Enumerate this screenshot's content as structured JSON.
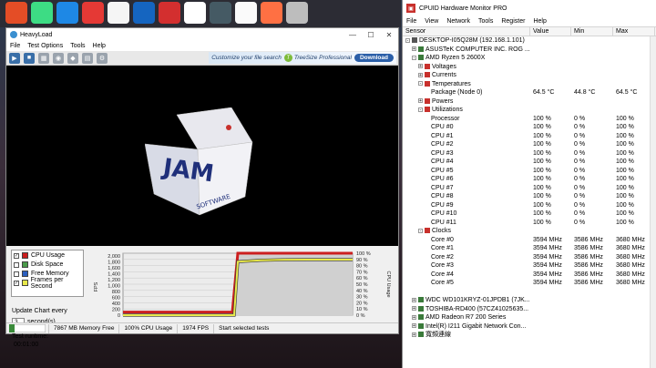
{
  "taskbar_icons": [
    "chrome-icon",
    "android-icon",
    "download-icon",
    "square-icon",
    "pinball-icon",
    "pdf-icon",
    "photo-icon",
    "cube-icon",
    "pdf-red-icon",
    "calendar-icon",
    "fire-icon",
    "tv-icon"
  ],
  "heavyload": {
    "title": "HeavyLoad",
    "menu": [
      "File",
      "Test Options",
      "Tools",
      "Help"
    ],
    "ad_text": "Customize your file search",
    "ad_brand": "TreeSize Professional",
    "ad_button": "Download",
    "legend": [
      {
        "label": "CPU Usage",
        "checked": true,
        "color": "#cc1f1f"
      },
      {
        "label": "Disk Space",
        "checked": false,
        "color": "#4a9a4a"
      },
      {
        "label": "Free Memory",
        "checked": false,
        "color": "#2b5fbf"
      },
      {
        "label": "Frames per Second",
        "checked": true,
        "color": "#e8e84a"
      }
    ],
    "update_label": "Update Chart every",
    "update_value": "3",
    "update_unit": "second(s)",
    "runtime_label": "Test runtime:",
    "runtime_value": "00:01:00",
    "status": [
      "7867 MB Memory Free",
      "100% CPU Usage",
      "1974 FPS",
      "Start selected tests"
    ]
  },
  "chart_data": {
    "type": "area",
    "x": [
      0,
      1,
      2,
      3,
      4,
      5,
      6,
      7,
      8,
      9,
      10
    ],
    "series": [
      {
        "name": "CPU Usage",
        "values": [
          5,
          5,
          5,
          5,
          5,
          100,
          100,
          100,
          100,
          100,
          100
        ]
      },
      {
        "name": "Frames per Second",
        "values": [
          0,
          0,
          0,
          0,
          0,
          1900,
          1950,
          1970,
          1974,
          1974,
          1974
        ]
      }
    ],
    "ylabel_left": "FPS",
    "ylabel_right": "CPU Usage",
    "ylim_left": [
      0,
      2200
    ],
    "yticks_left": [
      "2,000",
      "1,800",
      "1,600",
      "1,400",
      "1,200",
      "1,000",
      "800",
      "600",
      "400",
      "200",
      "0"
    ],
    "ylim_right": [
      0,
      100
    ],
    "yticks_right": [
      "100 %",
      "90 %",
      "80 %",
      "70 %",
      "60 %",
      "50 %",
      "40 %",
      "30 %",
      "20 %",
      "10 %",
      "0 %"
    ],
    "grid": true
  },
  "hwmonitor": {
    "title": "CPUID Hardware Monitor PRO",
    "menu": [
      "File",
      "View",
      "Network",
      "Tools",
      "Register",
      "Help"
    ],
    "columns": [
      "Sensor",
      "Value",
      "Min",
      "Max"
    ],
    "rows": [
      {
        "name": "DESKTOP-I05Q28M (192.168.1.101)",
        "value": "",
        "min": "",
        "max": "",
        "indent": 0,
        "exp": "-"
      },
      {
        "name": "ASUSTeK COMPUTER INC. ROG ...",
        "value": "",
        "min": "",
        "max": "",
        "indent": 1,
        "exp": "+"
      },
      {
        "name": "AMD Ryzen 5 2600X",
        "value": "",
        "min": "",
        "max": "",
        "indent": 1,
        "exp": "-"
      },
      {
        "name": "Voltages",
        "value": "",
        "min": "",
        "max": "",
        "indent": 2,
        "exp": "+"
      },
      {
        "name": "Currents",
        "value": "",
        "min": "",
        "max": "",
        "indent": 2,
        "exp": "+"
      },
      {
        "name": "Temperatures",
        "value": "",
        "min": "",
        "max": "",
        "indent": 2,
        "exp": "-"
      },
      {
        "name": "Package (Node 0)",
        "value": "64.5 °C",
        "min": "44.8 °C",
        "max": "64.5 °C",
        "indent": 4,
        "exp": ""
      },
      {
        "name": "Powers",
        "value": "",
        "min": "",
        "max": "",
        "indent": 2,
        "exp": "+"
      },
      {
        "name": "Utilizations",
        "value": "",
        "min": "",
        "max": "",
        "indent": 2,
        "exp": "-"
      },
      {
        "name": "Processor",
        "value": "100 %",
        "min": "0 %",
        "max": "100 %",
        "indent": 4,
        "exp": ""
      },
      {
        "name": "CPU #0",
        "value": "100 %",
        "min": "0 %",
        "max": "100 %",
        "indent": 4,
        "exp": ""
      },
      {
        "name": "CPU #1",
        "value": "100 %",
        "min": "0 %",
        "max": "100 %",
        "indent": 4,
        "exp": ""
      },
      {
        "name": "CPU #2",
        "value": "100 %",
        "min": "0 %",
        "max": "100 %",
        "indent": 4,
        "exp": ""
      },
      {
        "name": "CPU #3",
        "value": "100 %",
        "min": "0 %",
        "max": "100 %",
        "indent": 4,
        "exp": ""
      },
      {
        "name": "CPU #4",
        "value": "100 %",
        "min": "0 %",
        "max": "100 %",
        "indent": 4,
        "exp": ""
      },
      {
        "name": "CPU #5",
        "value": "100 %",
        "min": "0 %",
        "max": "100 %",
        "indent": 4,
        "exp": ""
      },
      {
        "name": "CPU #6",
        "value": "100 %",
        "min": "0 %",
        "max": "100 %",
        "indent": 4,
        "exp": ""
      },
      {
        "name": "CPU #7",
        "value": "100 %",
        "min": "0 %",
        "max": "100 %",
        "indent": 4,
        "exp": ""
      },
      {
        "name": "CPU #8",
        "value": "100 %",
        "min": "0 %",
        "max": "100 %",
        "indent": 4,
        "exp": ""
      },
      {
        "name": "CPU #9",
        "value": "100 %",
        "min": "0 %",
        "max": "100 %",
        "indent": 4,
        "exp": ""
      },
      {
        "name": "CPU #10",
        "value": "100 %",
        "min": "0 %",
        "max": "100 %",
        "indent": 4,
        "exp": ""
      },
      {
        "name": "CPU #11",
        "value": "100 %",
        "min": "0 %",
        "max": "100 %",
        "indent": 4,
        "exp": ""
      },
      {
        "name": "Clocks",
        "value": "",
        "min": "",
        "max": "",
        "indent": 2,
        "exp": "-"
      },
      {
        "name": "Core #0",
        "value": "3594 MHz",
        "min": "3586 MHz",
        "max": "3680 MHz",
        "indent": 4,
        "exp": ""
      },
      {
        "name": "Core #1",
        "value": "3594 MHz",
        "min": "3586 MHz",
        "max": "3680 MHz",
        "indent": 4,
        "exp": ""
      },
      {
        "name": "Core #2",
        "value": "3594 MHz",
        "min": "3586 MHz",
        "max": "3680 MHz",
        "indent": 4,
        "exp": ""
      },
      {
        "name": "Core #3",
        "value": "3594 MHz",
        "min": "3586 MHz",
        "max": "3680 MHz",
        "indent": 4,
        "exp": ""
      },
      {
        "name": "Core #4",
        "value": "3594 MHz",
        "min": "3586 MHz",
        "max": "3680 MHz",
        "indent": 4,
        "exp": ""
      },
      {
        "name": "Core #5",
        "value": "3594 MHz",
        "min": "3586 MHz",
        "max": "3680 MHz",
        "indent": 4,
        "exp": ""
      },
      {
        "name": "",
        "value": "",
        "min": "",
        "max": "",
        "indent": 0,
        "exp": ""
      },
      {
        "name": "WDC WD101KRYZ-01JPDB1 (7JK...",
        "value": "",
        "min": "",
        "max": "",
        "indent": 1,
        "exp": "+"
      },
      {
        "name": "TOSHIBA-RD400 (57CZ41025635...",
        "value": "",
        "min": "",
        "max": "",
        "indent": 1,
        "exp": "+"
      },
      {
        "name": "AMD Radeon R7 200 Series",
        "value": "",
        "min": "",
        "max": "",
        "indent": 1,
        "exp": "+"
      },
      {
        "name": "Intel(R) I211 Gigabit Network Con...",
        "value": "",
        "min": "",
        "max": "",
        "indent": 1,
        "exp": "+"
      },
      {
        "name": "寬頻連線",
        "value": "",
        "min": "",
        "max": "",
        "indent": 1,
        "exp": "+"
      }
    ]
  },
  "colors": {
    "cpu": "#cc1f1f",
    "fps": "#e8e84a",
    "accent": "#2b5fa8"
  }
}
